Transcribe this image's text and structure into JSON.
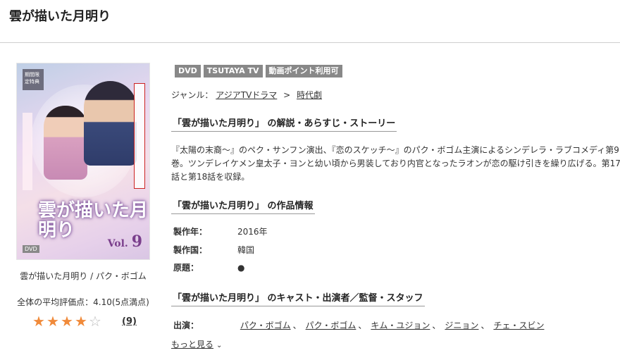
{
  "page": {
    "title": "雲が描いた月明り"
  },
  "cover": {
    "badge": "期間限定特典",
    "title": "雲が描いた月明り",
    "vol_label": "Vol.",
    "vol_number": "9",
    "format": "DVD"
  },
  "caption": "雲が描いた月明り / パク・ボゴム",
  "rating": {
    "text": "全体の平均評価点：4.10(5点満点)",
    "value": 4.1,
    "max": 5,
    "reviews": "(9)",
    "star_color": "#f08a3a"
  },
  "tags": [
    "DVD",
    "TSUTAYA TV",
    "動画ポイント利用可"
  ],
  "genre": {
    "label": "ジャンル：",
    "items": [
      "アジアTVドラマ",
      "時代劇"
    ],
    "separator": ">"
  },
  "sections": {
    "synopsis_heading": "「雲が描いた月明り」 の解説・あらすじ・ストーリー",
    "synopsis_text": "『太陽の末裔～』のペク・サンフン演出、『恋のスケッチ～』のパク・ボゴム主演によるシンデレラ・ラブコメディ第9巻。ツンデレイケメン皇太子・ヨンと幼い頃から男装しており内官となったラオンが恋の駆け引きを繰り広げる。第17話と第18話を収録。",
    "info_heading": "「雲が描いた月明り」 の作品情報",
    "info": [
      {
        "key": "製作年：",
        "value": "2016年"
      },
      {
        "key": "製作国：",
        "value": "韓国"
      },
      {
        "key": "原題：",
        "value": "●"
      }
    ],
    "cast_heading": "「雲が描いた月明り」 のキャスト・出演者／監督・スタッフ",
    "cast_label": "出演：",
    "cast": [
      "パク・ボゴム",
      "パク・ボゴム",
      "キム・ユジョン",
      "ジニョン",
      "チェ・スビン"
    ],
    "more": "もっと見る"
  }
}
